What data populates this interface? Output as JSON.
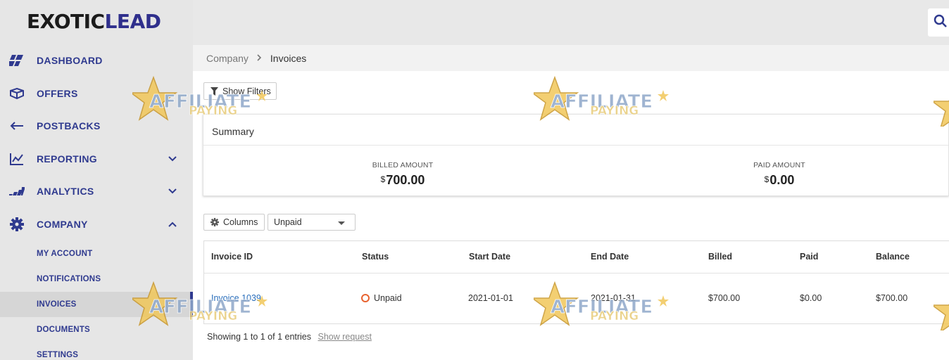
{
  "brand": {
    "part1": "EXOTIC",
    "part2": "LEAD"
  },
  "sidebar": {
    "items": [
      {
        "label": "DASHBOARD",
        "icon": "dashboard-icon"
      },
      {
        "label": "OFFERS",
        "icon": "box-icon"
      },
      {
        "label": "POSTBACKS",
        "icon": "arrow-left-icon"
      },
      {
        "label": "REPORTING",
        "icon": "line-chart-icon",
        "chevron": "down"
      },
      {
        "label": "ANALYTICS",
        "icon": "analytics-icon",
        "chevron": "down"
      },
      {
        "label": "COMPANY",
        "icon": "gear-icon",
        "chevron": "up"
      }
    ],
    "subitems": [
      {
        "label": "MY ACCOUNT"
      },
      {
        "label": "NOTIFICATIONS"
      },
      {
        "label": "INVOICES",
        "active": true
      },
      {
        "label": "DOCUMENTS"
      },
      {
        "label": "SETTINGS"
      }
    ]
  },
  "breadcrumb": {
    "parent": "Company",
    "current": "Invoices"
  },
  "toolbar": {
    "show_filters": "Show Filters",
    "columns": "Columns",
    "status_filter": "Unpaid"
  },
  "summary": {
    "title": "Summary",
    "billed_label": "BILLED AMOUNT",
    "billed_currency": "$",
    "billed_value": "700.00",
    "paid_label": "PAID AMOUNT",
    "paid_currency": "$",
    "paid_value": "0.00"
  },
  "table": {
    "headers": [
      "Invoice ID",
      "Status",
      "Start Date",
      "End Date",
      "Billed",
      "Paid",
      "Balance"
    ],
    "rows": [
      {
        "invoice_id": "Invoice 1039",
        "status": "Unpaid",
        "start_date": "2021-01-01",
        "end_date": "2021-01-31",
        "billed": "$700.00",
        "paid": "$0.00",
        "balance": "$700.00"
      }
    ]
  },
  "footer": {
    "info": "Showing 1 to 1 of 1 entries",
    "show_request": "Show request"
  },
  "watermark": {
    "line1": "AFFILIATE",
    "line2": "PAYING"
  },
  "colors": {
    "nav": "#2f3a8f",
    "brand_dark": "#1b1b1b",
    "brand_blue": "#2f2f8c",
    "status_unpaid": "#e8622f",
    "link": "#2a6ebb"
  }
}
